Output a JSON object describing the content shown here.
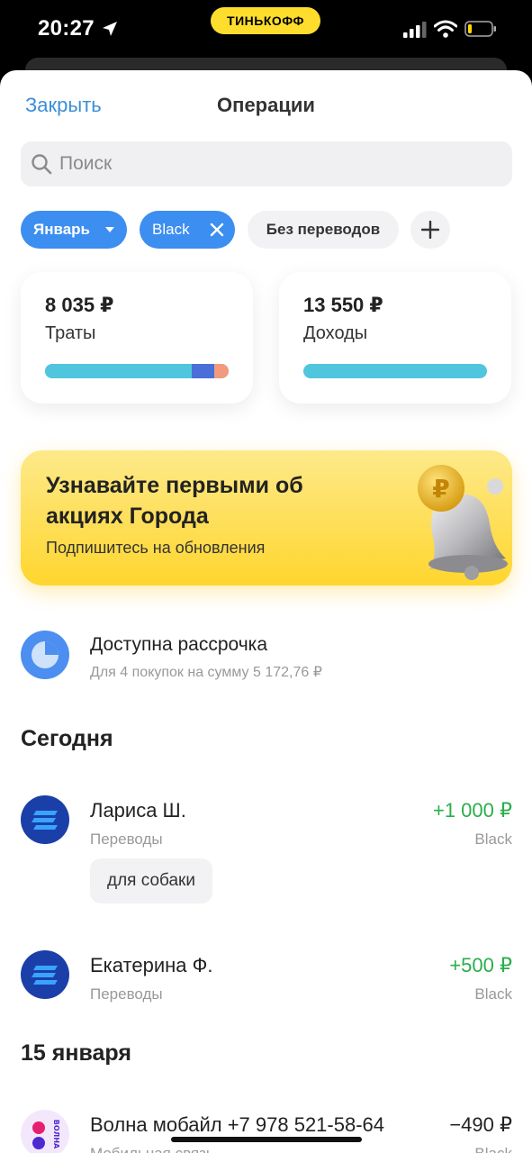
{
  "status_bar": {
    "time": "20:27",
    "brand": "ТИНЬКОФФ"
  },
  "header": {
    "close_label": "Закрыть",
    "title": "Операции"
  },
  "search": {
    "placeholder": "Поиск"
  },
  "filters": {
    "month": "Январь",
    "card": "Black",
    "no_transfers": "Без переводов"
  },
  "summary": {
    "expenses": {
      "amount": "8 035 ₽",
      "label": "Траты",
      "segments": [
        {
          "share": 0.8,
          "color": "#4fc6de"
        },
        {
          "share": 0.12,
          "color": "#4a6fd8"
        },
        {
          "share": 0.08,
          "color": "#f39a7e"
        }
      ]
    },
    "income": {
      "amount": "13 550 ₽",
      "label": "Доходы",
      "segments": [
        {
          "share": 1.0,
          "color": "#4fc6de"
        }
      ]
    }
  },
  "promo": {
    "title": "Узнавайте первыми об акциях Города",
    "subtitle": "Подпишитесь на обновления"
  },
  "installment": {
    "title": "Доступна рассрочка",
    "subtitle": "Для 4 покупок на сумму 5 172,76 ₽"
  },
  "sections": {
    "today": "Сегодня",
    "jan15": "15 января"
  },
  "operations": [
    {
      "name": "Лариса Ш.",
      "category": "Переводы",
      "amount": "+1 000 ₽",
      "account": "Black",
      "note": "для собаки"
    },
    {
      "name": "Екатерина Ф.",
      "category": "Переводы",
      "amount": "+500 ₽",
      "account": "Black"
    },
    {
      "name": "Волна мобайл +7 978 521-58-64",
      "category": "Мобильная связь",
      "amount": "−490 ₽",
      "account": "Black",
      "logo_text": "ВОЛНА"
    }
  ],
  "colors": {
    "accent_blue": "#3c8ef0",
    "income_green": "#2aae4a",
    "promo_yellow": "#ffd62e"
  }
}
